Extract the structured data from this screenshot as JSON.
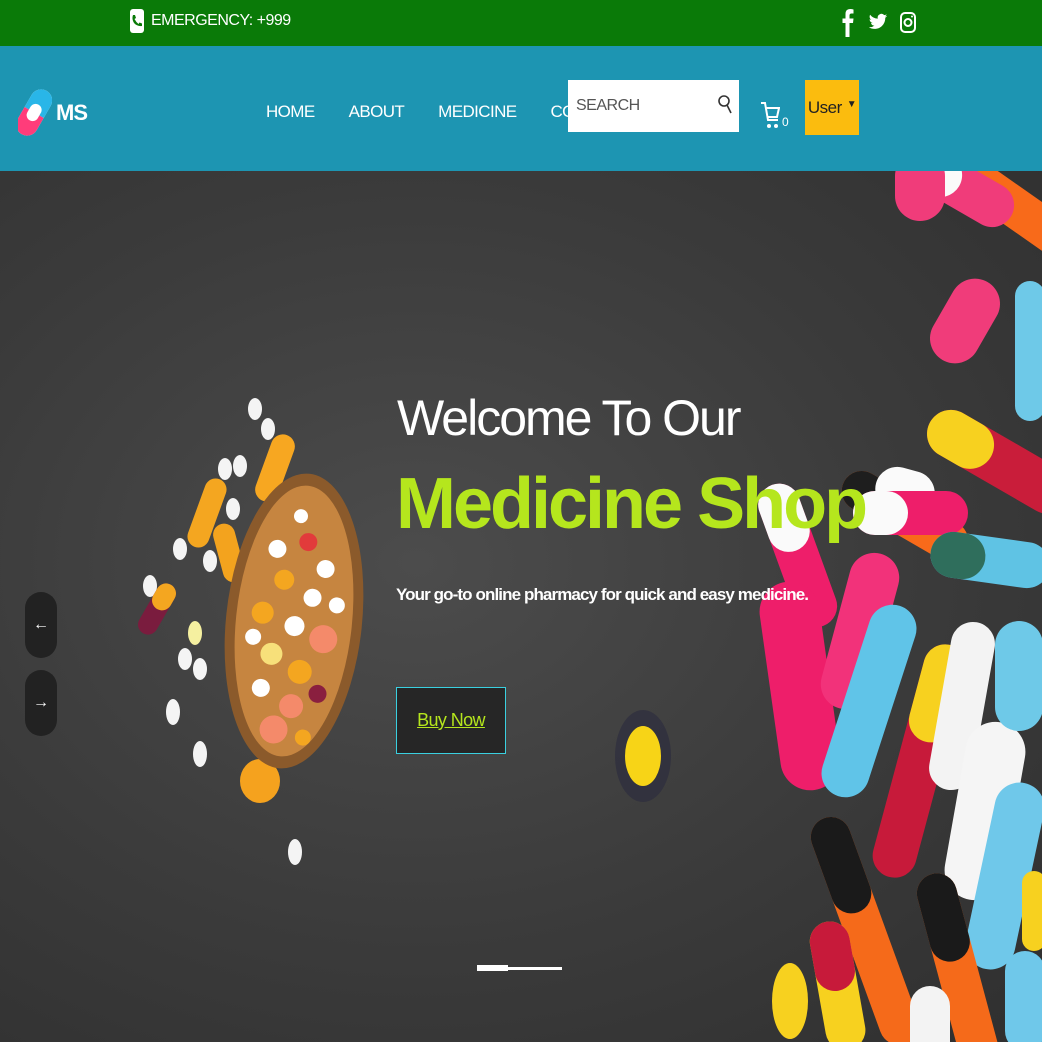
{
  "topbar": {
    "emergency": "EMERGENCY: +999",
    "social": [
      {
        "icon": "facebook-icon"
      },
      {
        "icon": "twitter-icon"
      },
      {
        "icon": "instagram-icon"
      }
    ]
  },
  "header": {
    "logo_text": "MS",
    "nav": {
      "home": "HOME",
      "about": "ABOUT",
      "medicine": "MEDICINE",
      "contact": "CONTACT US"
    },
    "search": {
      "placeholder": "SEARCH",
      "value": ""
    },
    "cart": {
      "count": "0"
    },
    "user_button": "User"
  },
  "hero": {
    "welcome": "Welcome To Our",
    "title": "Medicine Shop",
    "tagline": "Your go-to online pharmacy for quick and easy medicine.",
    "cta": "Buy Now",
    "prev_arrow": "←",
    "next_arrow": "→",
    "slides_active": 1,
    "slides_total": 2
  },
  "colors": {
    "topbar": "#0a7a08",
    "header": "#1d95b2",
    "accent_green": "#b5e61d",
    "user_button": "#fbbc0e"
  }
}
